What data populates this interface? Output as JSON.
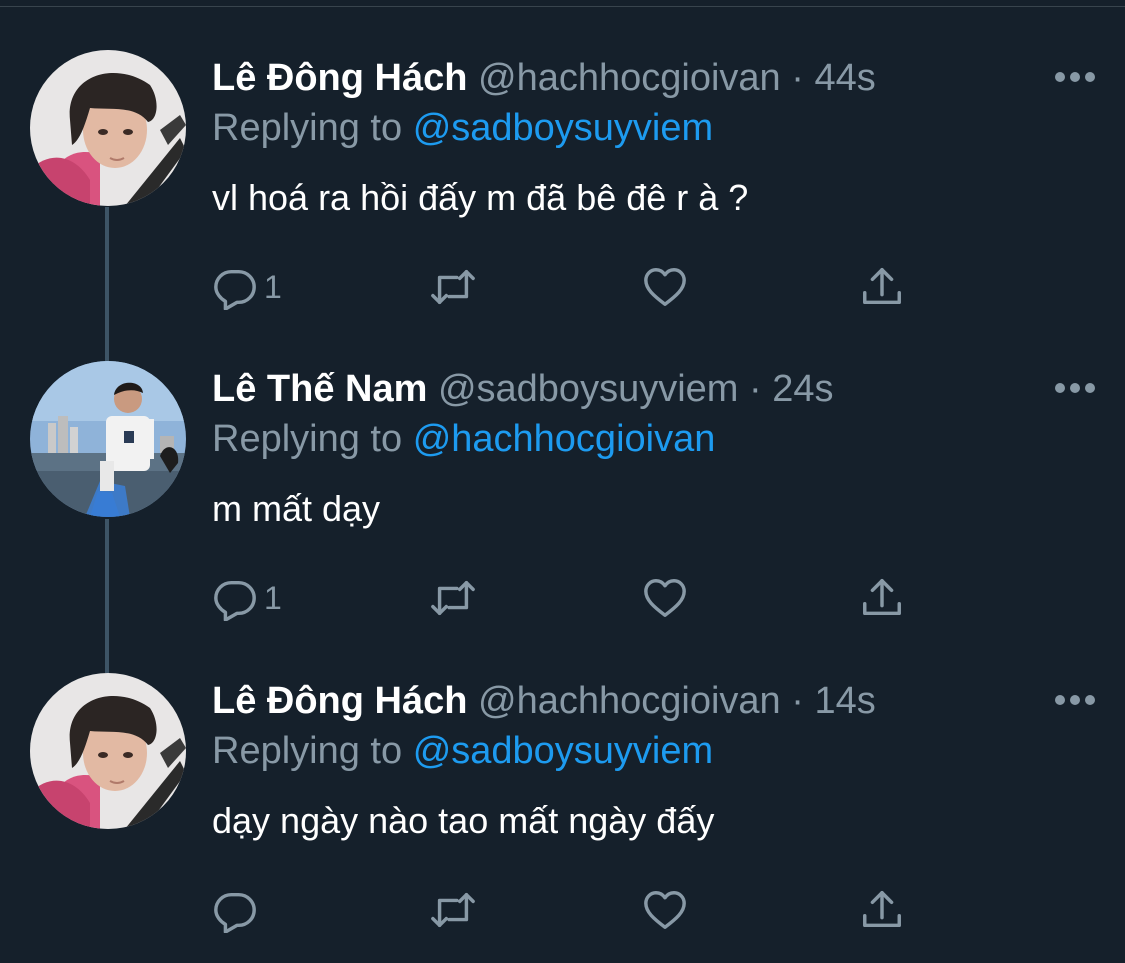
{
  "tweets": [
    {
      "name": "Lê Đông Hách",
      "handle": "@hachhocgioivan",
      "separator": "·",
      "time": "44s",
      "replying_prefix": "Replying to",
      "replying_to": "@sadboysuyviem",
      "text": "vl hoá ra hồi đấy m đã bê đê r à ?",
      "reply_count": "1",
      "avatar": "boy-pink-hoodie-avatar"
    },
    {
      "name": "Lê Thế Nam",
      "handle": "@sadboysuyviem",
      "separator": "·",
      "time": "24s",
      "replying_prefix": "Replying to",
      "replying_to": "@hachhocgioivan",
      "text": "m mất dạy",
      "reply_count": "1",
      "avatar": "man-on-boat-avatar"
    },
    {
      "name": "Lê Đông Hách",
      "handle": "@hachhocgioivan",
      "separator": "·",
      "time": "14s",
      "replying_prefix": "Replying to",
      "replying_to": "@sadboysuyviem",
      "text": "dạy ngày nào tao mất ngày đấy",
      "reply_count": "",
      "avatar": "boy-pink-hoodie-avatar"
    }
  ],
  "icons": [
    "reply-icon",
    "retweet-icon",
    "like-icon",
    "share-icon",
    "more-icon"
  ],
  "colors": {
    "background": "#15202b",
    "mention": "#1d9bf0",
    "muted": "#8899a6",
    "thread_line": "#3d5466"
  }
}
